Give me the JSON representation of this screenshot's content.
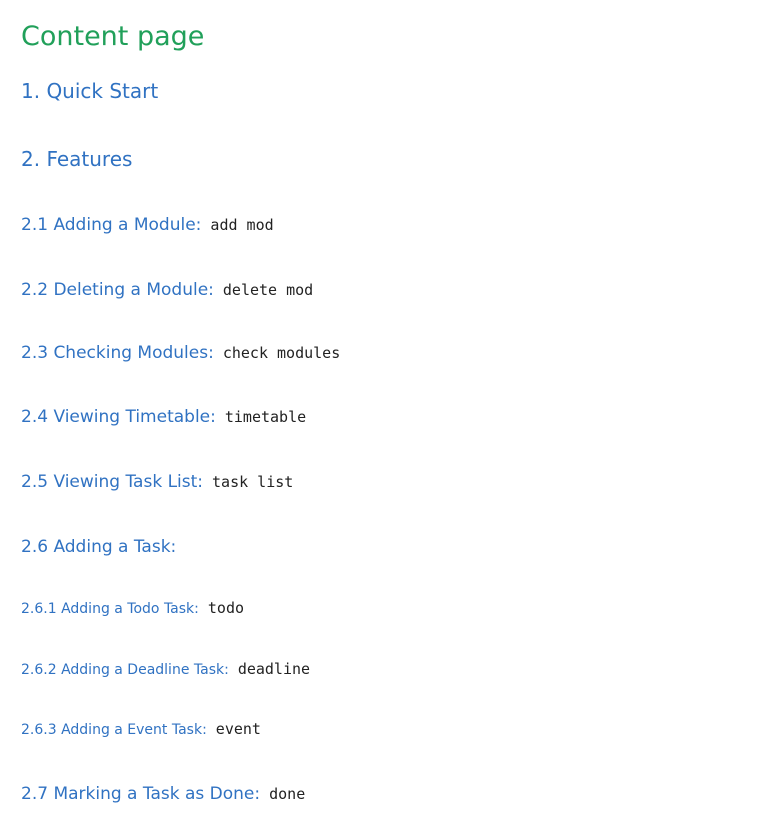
{
  "page": {
    "title": "Content page"
  },
  "toc": {
    "quick_start": "1. Quick Start",
    "features": "2. Features",
    "items": [
      {
        "label": "2.1 Adding a Module:",
        "command": "add mod"
      },
      {
        "label": "2.2 Deleting a Module:",
        "command": "delete mod"
      },
      {
        "label": "2.3 Checking Modules:",
        "command": "check modules"
      },
      {
        "label": "2.4 Viewing Timetable:",
        "command": "timetable"
      },
      {
        "label": "2.5 Viewing Task List:",
        "command": "task list"
      },
      {
        "label": "2.6 Adding a Task:",
        "command": ""
      },
      {
        "label": "2.6.1 Adding a Todo Task:",
        "command": "todo"
      },
      {
        "label": "2.6.2 Adding a Deadline Task:",
        "command": "deadline"
      },
      {
        "label": "2.6.3 Adding a Event Task:",
        "command": "event"
      },
      {
        "label": "2.7 Marking a Task as Done:",
        "command": "done"
      }
    ]
  },
  "colors": {
    "title": "#21a05a",
    "link": "#3072c2",
    "code": "#222222"
  }
}
